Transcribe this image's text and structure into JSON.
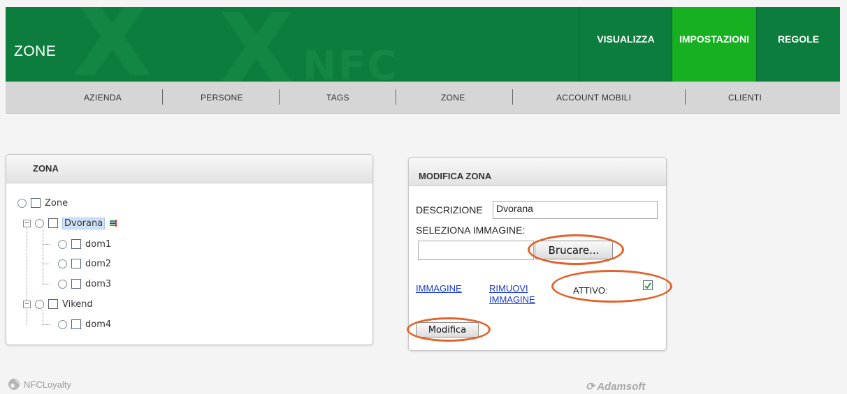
{
  "header": {
    "title": "ZONE",
    "watermark": "NFC",
    "nav": [
      "VISUALIZZA",
      "IMPOSTAZIONI",
      "REGOLE"
    ],
    "active_nav": "IMPOSTAZIONI"
  },
  "subnav": [
    "AZIENDA",
    "PERSONE",
    "TAGS",
    "ZONE",
    "ACCOUNT MOBILI",
    "CLIENTI"
  ],
  "zona_panel": {
    "title": "ZONA",
    "tree": {
      "root": "Zone",
      "nodes": [
        {
          "label": "Dvorana",
          "selected": true,
          "children": [
            "dom1",
            "dom2",
            "dom3"
          ]
        },
        {
          "label": "Vikend",
          "selected": false,
          "children": [
            "dom4"
          ]
        }
      ]
    }
  },
  "modifica_panel": {
    "title": "MODIFICA ZONA",
    "descrizione_label": "DESCRIZIONE",
    "descrizione_value": "Dvorana",
    "seleziona_label": "SELEZIONA IMMAGINE:",
    "file_value": "",
    "browse_button": "Brucare...",
    "immagine_link": "IMMAGINE",
    "rimuovi_link_1": "RIMUOVI",
    "rimuovi_link_2": "IMMAGINE",
    "attivo_label": "ATTIVO:",
    "attivo_checked": true,
    "modifica_button": "Modifica"
  },
  "footer": {
    "left_brand": "NFCLoyalty",
    "right_brand": "Adamsoft"
  },
  "colors": {
    "header_green": "#0d7d3d",
    "active_tab": "#16b020",
    "highlight_ellipse": "#e2622b",
    "link": "#1a3bd1"
  }
}
